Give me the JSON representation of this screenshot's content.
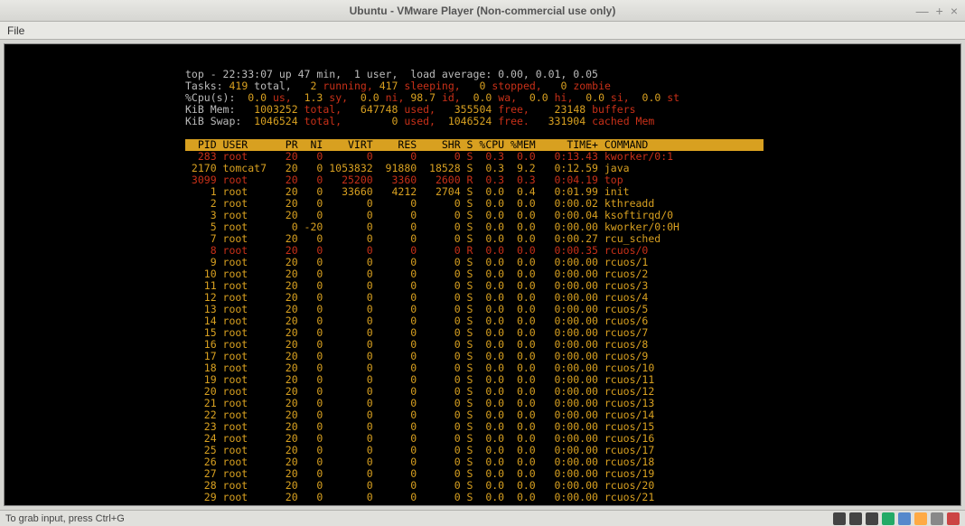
{
  "window": {
    "title": "Ubuntu - VMware Player (Non-commercial use only)",
    "menu_file": "File",
    "status": "To grab input, press Ctrl+G"
  },
  "top": {
    "uptime_line": "top - 22:33:07 up 47 min,  1 user,  load average: 0.00, 0.01, 0.05",
    "tasks_prefix": "Tasks: ",
    "tasks_total": "419",
    "tasks_total_lbl": " total,   ",
    "tasks_running": "2",
    "tasks_running_lbl": " running, ",
    "tasks_sleeping": "417",
    "tasks_sleeping_lbl": " sleeping,   ",
    "tasks_stopped": "0",
    "tasks_stopped_lbl": " stopped,   ",
    "tasks_zombie": "0",
    "tasks_zombie_lbl": " zombie",
    "cpu_prefix": "%Cpu(s):  ",
    "cpu_us": "0.0",
    "cpu_us_lbl": " us,  ",
    "cpu_sy": "1.3",
    "cpu_sy_lbl": " sy,  ",
    "cpu_ni": "0.0",
    "cpu_ni_lbl": " ni, ",
    "cpu_id": "98.7",
    "cpu_id_lbl": " id,  ",
    "cpu_wa": "0.0",
    "cpu_wa_lbl": " wa,  ",
    "cpu_hi": "0.0",
    "cpu_hi_lbl": " hi,  ",
    "cpu_si": "0.0",
    "cpu_si_lbl": " si,  ",
    "cpu_st": "0.0",
    "cpu_st_lbl": " st",
    "mem_prefix": "KiB Mem:   ",
    "mem_total": "1003252",
    "mem_total_lbl": " total,   ",
    "mem_used": "647748",
    "mem_used_lbl": " used,   ",
    "mem_free": "355504",
    "mem_free_lbl": " free,    ",
    "mem_buf": "23148",
    "mem_buf_lbl": " buffers",
    "swap_prefix": "KiB Swap:  ",
    "swap_total": "1046524",
    "swap_total_lbl": " total,        ",
    "swap_used": "0",
    "swap_used_lbl": " used,  ",
    "swap_free": "1046524",
    "swap_free_lbl": " free.   ",
    "swap_cache": "331904",
    "swap_cache_lbl": " cached Mem",
    "header": "  PID USER      PR  NI    VIRT    RES    SHR S %CPU %MEM     TIME+ COMMAND                    "
  },
  "rows": [
    {
      "pid": "283",
      "user": "root",
      "pr": "20",
      "ni": "0",
      "virt": "0",
      "res": "0",
      "shr": "0",
      "s": "S",
      "cpu": "0.3",
      "mem": "0.0",
      "time": "0:13.43",
      "cmd": "kworker/0:1",
      "hl": true
    },
    {
      "pid": "2170",
      "user": "tomcat7",
      "pr": "20",
      "ni": "0",
      "virt": "1053832",
      "res": "91880",
      "shr": "18528",
      "s": "S",
      "cpu": "0.3",
      "mem": "9.2",
      "time": "0:12.59",
      "cmd": "java",
      "hl": false
    },
    {
      "pid": "3099",
      "user": "root",
      "pr": "20",
      "ni": "0",
      "virt": "25200",
      "res": "3360",
      "shr": "2600",
      "s": "R",
      "cpu": "0.3",
      "mem": "0.3",
      "time": "0:04.19",
      "cmd": "top",
      "hl": true
    },
    {
      "pid": "1",
      "user": "root",
      "pr": "20",
      "ni": "0",
      "virt": "33660",
      "res": "4212",
      "shr": "2704",
      "s": "S",
      "cpu": "0.0",
      "mem": "0.4",
      "time": "0:01.99",
      "cmd": "init",
      "hl": false
    },
    {
      "pid": "2",
      "user": "root",
      "pr": "20",
      "ni": "0",
      "virt": "0",
      "res": "0",
      "shr": "0",
      "s": "S",
      "cpu": "0.0",
      "mem": "0.0",
      "time": "0:00.02",
      "cmd": "kthreadd",
      "hl": false
    },
    {
      "pid": "3",
      "user": "root",
      "pr": "20",
      "ni": "0",
      "virt": "0",
      "res": "0",
      "shr": "0",
      "s": "S",
      "cpu": "0.0",
      "mem": "0.0",
      "time": "0:00.04",
      "cmd": "ksoftirqd/0",
      "hl": false
    },
    {
      "pid": "5",
      "user": "root",
      "pr": "0",
      "ni": "-20",
      "virt": "0",
      "res": "0",
      "shr": "0",
      "s": "S",
      "cpu": "0.0",
      "mem": "0.0",
      "time": "0:00.00",
      "cmd": "kworker/0:0H",
      "hl": false
    },
    {
      "pid": "7",
      "user": "root",
      "pr": "20",
      "ni": "0",
      "virt": "0",
      "res": "0",
      "shr": "0",
      "s": "S",
      "cpu": "0.0",
      "mem": "0.0",
      "time": "0:00.27",
      "cmd": "rcu_sched",
      "hl": false
    },
    {
      "pid": "8",
      "user": "root",
      "pr": "20",
      "ni": "0",
      "virt": "0",
      "res": "0",
      "shr": "0",
      "s": "R",
      "cpu": "0.0",
      "mem": "0.0",
      "time": "0:00.35",
      "cmd": "rcuos/0",
      "hl": true
    },
    {
      "pid": "9",
      "user": "root",
      "pr": "20",
      "ni": "0",
      "virt": "0",
      "res": "0",
      "shr": "0",
      "s": "S",
      "cpu": "0.0",
      "mem": "0.0",
      "time": "0:00.00",
      "cmd": "rcuos/1",
      "hl": false
    },
    {
      "pid": "10",
      "user": "root",
      "pr": "20",
      "ni": "0",
      "virt": "0",
      "res": "0",
      "shr": "0",
      "s": "S",
      "cpu": "0.0",
      "mem": "0.0",
      "time": "0:00.00",
      "cmd": "rcuos/2",
      "hl": false
    },
    {
      "pid": "11",
      "user": "root",
      "pr": "20",
      "ni": "0",
      "virt": "0",
      "res": "0",
      "shr": "0",
      "s": "S",
      "cpu": "0.0",
      "mem": "0.0",
      "time": "0:00.00",
      "cmd": "rcuos/3",
      "hl": false
    },
    {
      "pid": "12",
      "user": "root",
      "pr": "20",
      "ni": "0",
      "virt": "0",
      "res": "0",
      "shr": "0",
      "s": "S",
      "cpu": "0.0",
      "mem": "0.0",
      "time": "0:00.00",
      "cmd": "rcuos/4",
      "hl": false
    },
    {
      "pid": "13",
      "user": "root",
      "pr": "20",
      "ni": "0",
      "virt": "0",
      "res": "0",
      "shr": "0",
      "s": "S",
      "cpu": "0.0",
      "mem": "0.0",
      "time": "0:00.00",
      "cmd": "rcuos/5",
      "hl": false
    },
    {
      "pid": "14",
      "user": "root",
      "pr": "20",
      "ni": "0",
      "virt": "0",
      "res": "0",
      "shr": "0",
      "s": "S",
      "cpu": "0.0",
      "mem": "0.0",
      "time": "0:00.00",
      "cmd": "rcuos/6",
      "hl": false
    },
    {
      "pid": "15",
      "user": "root",
      "pr": "20",
      "ni": "0",
      "virt": "0",
      "res": "0",
      "shr": "0",
      "s": "S",
      "cpu": "0.0",
      "mem": "0.0",
      "time": "0:00.00",
      "cmd": "rcuos/7",
      "hl": false
    },
    {
      "pid": "16",
      "user": "root",
      "pr": "20",
      "ni": "0",
      "virt": "0",
      "res": "0",
      "shr": "0",
      "s": "S",
      "cpu": "0.0",
      "mem": "0.0",
      "time": "0:00.00",
      "cmd": "rcuos/8",
      "hl": false
    },
    {
      "pid": "17",
      "user": "root",
      "pr": "20",
      "ni": "0",
      "virt": "0",
      "res": "0",
      "shr": "0",
      "s": "S",
      "cpu": "0.0",
      "mem": "0.0",
      "time": "0:00.00",
      "cmd": "rcuos/9",
      "hl": false
    },
    {
      "pid": "18",
      "user": "root",
      "pr": "20",
      "ni": "0",
      "virt": "0",
      "res": "0",
      "shr": "0",
      "s": "S",
      "cpu": "0.0",
      "mem": "0.0",
      "time": "0:00.00",
      "cmd": "rcuos/10",
      "hl": false
    },
    {
      "pid": "19",
      "user": "root",
      "pr": "20",
      "ni": "0",
      "virt": "0",
      "res": "0",
      "shr": "0",
      "s": "S",
      "cpu": "0.0",
      "mem": "0.0",
      "time": "0:00.00",
      "cmd": "rcuos/11",
      "hl": false
    },
    {
      "pid": "20",
      "user": "root",
      "pr": "20",
      "ni": "0",
      "virt": "0",
      "res": "0",
      "shr": "0",
      "s": "S",
      "cpu": "0.0",
      "mem": "0.0",
      "time": "0:00.00",
      "cmd": "rcuos/12",
      "hl": false
    },
    {
      "pid": "21",
      "user": "root",
      "pr": "20",
      "ni": "0",
      "virt": "0",
      "res": "0",
      "shr": "0",
      "s": "S",
      "cpu": "0.0",
      "mem": "0.0",
      "time": "0:00.00",
      "cmd": "rcuos/13",
      "hl": false
    },
    {
      "pid": "22",
      "user": "root",
      "pr": "20",
      "ni": "0",
      "virt": "0",
      "res": "0",
      "shr": "0",
      "s": "S",
      "cpu": "0.0",
      "mem": "0.0",
      "time": "0:00.00",
      "cmd": "rcuos/14",
      "hl": false
    },
    {
      "pid": "23",
      "user": "root",
      "pr": "20",
      "ni": "0",
      "virt": "0",
      "res": "0",
      "shr": "0",
      "s": "S",
      "cpu": "0.0",
      "mem": "0.0",
      "time": "0:00.00",
      "cmd": "rcuos/15",
      "hl": false
    },
    {
      "pid": "24",
      "user": "root",
      "pr": "20",
      "ni": "0",
      "virt": "0",
      "res": "0",
      "shr": "0",
      "s": "S",
      "cpu": "0.0",
      "mem": "0.0",
      "time": "0:00.00",
      "cmd": "rcuos/16",
      "hl": false
    },
    {
      "pid": "25",
      "user": "root",
      "pr": "20",
      "ni": "0",
      "virt": "0",
      "res": "0",
      "shr": "0",
      "s": "S",
      "cpu": "0.0",
      "mem": "0.0",
      "time": "0:00.00",
      "cmd": "rcuos/17",
      "hl": false
    },
    {
      "pid": "26",
      "user": "root",
      "pr": "20",
      "ni": "0",
      "virt": "0",
      "res": "0",
      "shr": "0",
      "s": "S",
      "cpu": "0.0",
      "mem": "0.0",
      "time": "0:00.00",
      "cmd": "rcuos/18",
      "hl": false
    },
    {
      "pid": "27",
      "user": "root",
      "pr": "20",
      "ni": "0",
      "virt": "0",
      "res": "0",
      "shr": "0",
      "s": "S",
      "cpu": "0.0",
      "mem": "0.0",
      "time": "0:00.00",
      "cmd": "rcuos/19",
      "hl": false
    },
    {
      "pid": "28",
      "user": "root",
      "pr": "20",
      "ni": "0",
      "virt": "0",
      "res": "0",
      "shr": "0",
      "s": "S",
      "cpu": "0.0",
      "mem": "0.0",
      "time": "0:00.00",
      "cmd": "rcuos/20",
      "hl": false
    },
    {
      "pid": "29",
      "user": "root",
      "pr": "20",
      "ni": "0",
      "virt": "0",
      "res": "0",
      "shr": "0",
      "s": "S",
      "cpu": "0.0",
      "mem": "0.0",
      "time": "0:00.00",
      "cmd": "rcuos/21",
      "hl": false
    }
  ]
}
